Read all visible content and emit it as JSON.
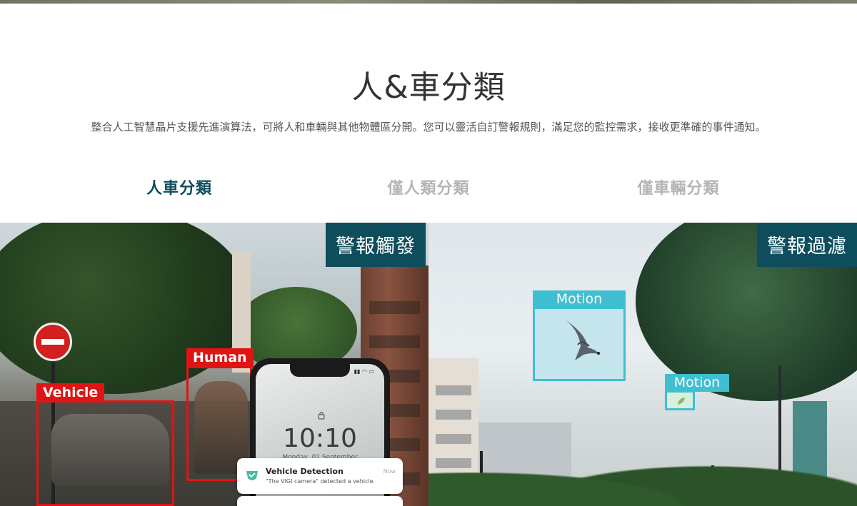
{
  "section": {
    "title": "人&車分類",
    "description": "整合人工智慧晶片支援先進演算法，可將人和車輛與其他物體區分開。您可以靈活自訂警報規則，滿足您的監控需求，接收更準確的事件通知。"
  },
  "tabs": [
    {
      "label": "人車分類",
      "active": true
    },
    {
      "label": "僅人類分類",
      "active": false
    },
    {
      "label": "僅車輛分類",
      "active": false
    }
  ],
  "left_panel": {
    "tag": "警報觸發",
    "detections": {
      "human": "Human",
      "vehicle": "Vehicle"
    },
    "phone": {
      "time": "10:10",
      "date": "Monday, 01 September",
      "notification": {
        "title": "Vehicle Detection",
        "text": "\"The VIGI camera\" detected a vehicle.",
        "time": "Now"
      }
    }
  },
  "right_panel": {
    "tag": "警報過濾",
    "motion_labels": [
      "Motion",
      "Motion"
    ]
  },
  "colors": {
    "accent": "#0e4d5c",
    "tab_inactive": "#b5b5b5",
    "detection_red": "#e01414",
    "motion_cyan": "#3fbfd0"
  }
}
